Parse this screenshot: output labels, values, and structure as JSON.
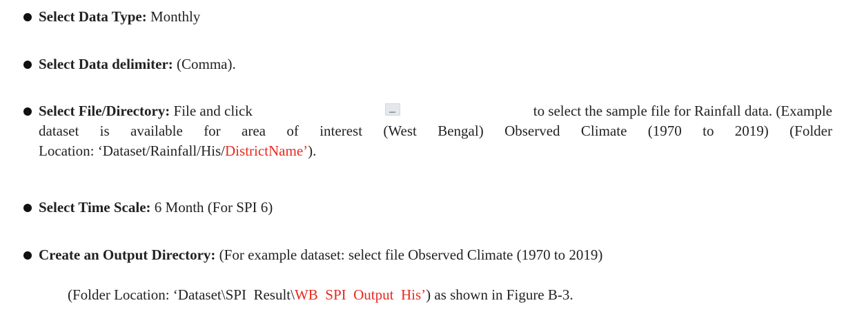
{
  "items": [
    {
      "label": "Select Data Type:",
      "value": " Monthly"
    },
    {
      "label": "Select Data delimiter:",
      "value": " (Comma)."
    },
    {
      "label": "Select File/Directory:",
      "line1_a": " File and click",
      "line1_b": "to select the sample file for Rainfall data. (Example",
      "line2": "dataset is available for area of interest (West Bengal) Observed Climate (1970 to 2019) (Folder",
      "line3_a": "Location: ‘Dataset/Rainfall/His/",
      "line3_red": "DistrictName’",
      "line3_b": ")."
    },
    {
      "label": "Select Time Scale:",
      "value": " 6 Month (For SPI 6)"
    },
    {
      "label": "Create an Output Directory:",
      "line1": " (For example dataset: select file Observed Climate (1970 to 2019)",
      "line2_a": "(Folder Location: ‘Dataset\\SPI  Result\\",
      "line2_red": "WB  SPI  Output  His’",
      "line2_b": ") as shown in Figure B-3."
    }
  ],
  "icons": {
    "file_button": "file-browse-icon"
  }
}
